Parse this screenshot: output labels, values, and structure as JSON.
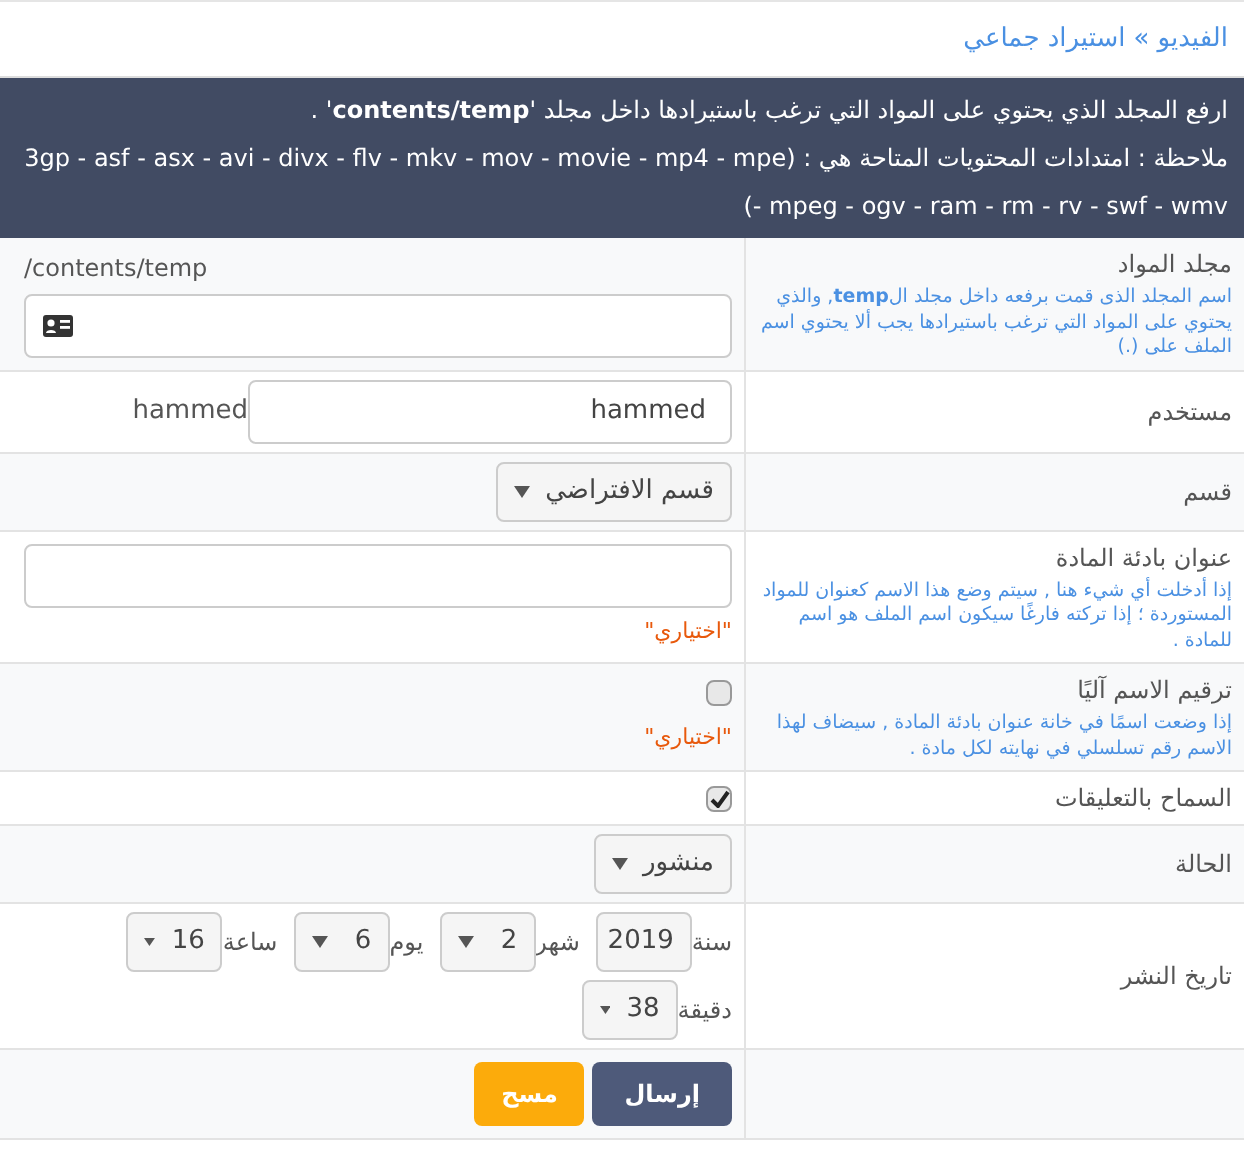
{
  "breadcrumb": {
    "items": [
      "الفيديو",
      "استيراد جماعي"
    ],
    "separator": "»"
  },
  "notice": {
    "lines": [
      "ارفع المجلد الذي يحتوي على المواد التي ترغب باستيرادها داخل مجلد '**contents/temp**' .",
      "ملاحظة : امتدادات المحتويات المتاحة هي : (3gp - asf - asx - avi - divx - flv - mkv - mov - movie - mp4 - mpe - mpeg - ogv - ram - rm - rv - swf - wmv)"
    ]
  },
  "rows": [
    {
      "kind": "folder",
      "label": "مجلد المواد",
      "hint": "اسم المجلد الذى قمت برفعه داخل مجلد ال**temp**, والذي يحتوي على المواد التي ترغب باستيرادها يجب ألا يحتوي اسم الملف على (.)",
      "path": "/contents/temp"
    },
    {
      "kind": "text",
      "label": "مستخدم",
      "value": "hammed",
      "suffix": "hammed"
    },
    {
      "kind": "select",
      "label": "قسم",
      "value": "قسم الافتراضي"
    },
    {
      "kind": "input",
      "label": "عنوان بادئة المادة",
      "hint": "إذا أدخلت أي شيء هنا , سيتم وضع هذا الاسم كعنوان للمواد المستوردة ؛ إذا تركته فارغًا سيكون اسم الملف هو اسم للمادة .",
      "note": "\"اختياري\""
    },
    {
      "kind": "checkbox",
      "label": "ترقيم الاسم آليًا",
      "hint": "إذا وضعت اسمًا في خانة عنوان بادئة المادة , سيضاف لهذا الاسم رقم تسلسلي في نهايته لكل مادة .",
      "checked": false,
      "note": "\"اختياري\""
    },
    {
      "kind": "checkbox",
      "label": "السماح بالتعليقات",
      "checked": true
    },
    {
      "kind": "select",
      "label": "الحالة",
      "value": "منشور"
    },
    {
      "kind": "date",
      "label": "تاريخ النشر",
      "parts": [
        {
          "label": "سنة",
          "value": "2019"
        },
        {
          "label": "شهر",
          "value": "2"
        },
        {
          "label": "يوم",
          "value": "6"
        },
        {
          "label": "ساعة",
          "value": "16"
        },
        {
          "label": "دقيقة",
          "value": "38"
        }
      ]
    }
  ],
  "buttons": [
    {
      "label": "إرسال",
      "kind": "primary"
    },
    {
      "label": "مسح",
      "kind": "warning"
    }
  ]
}
